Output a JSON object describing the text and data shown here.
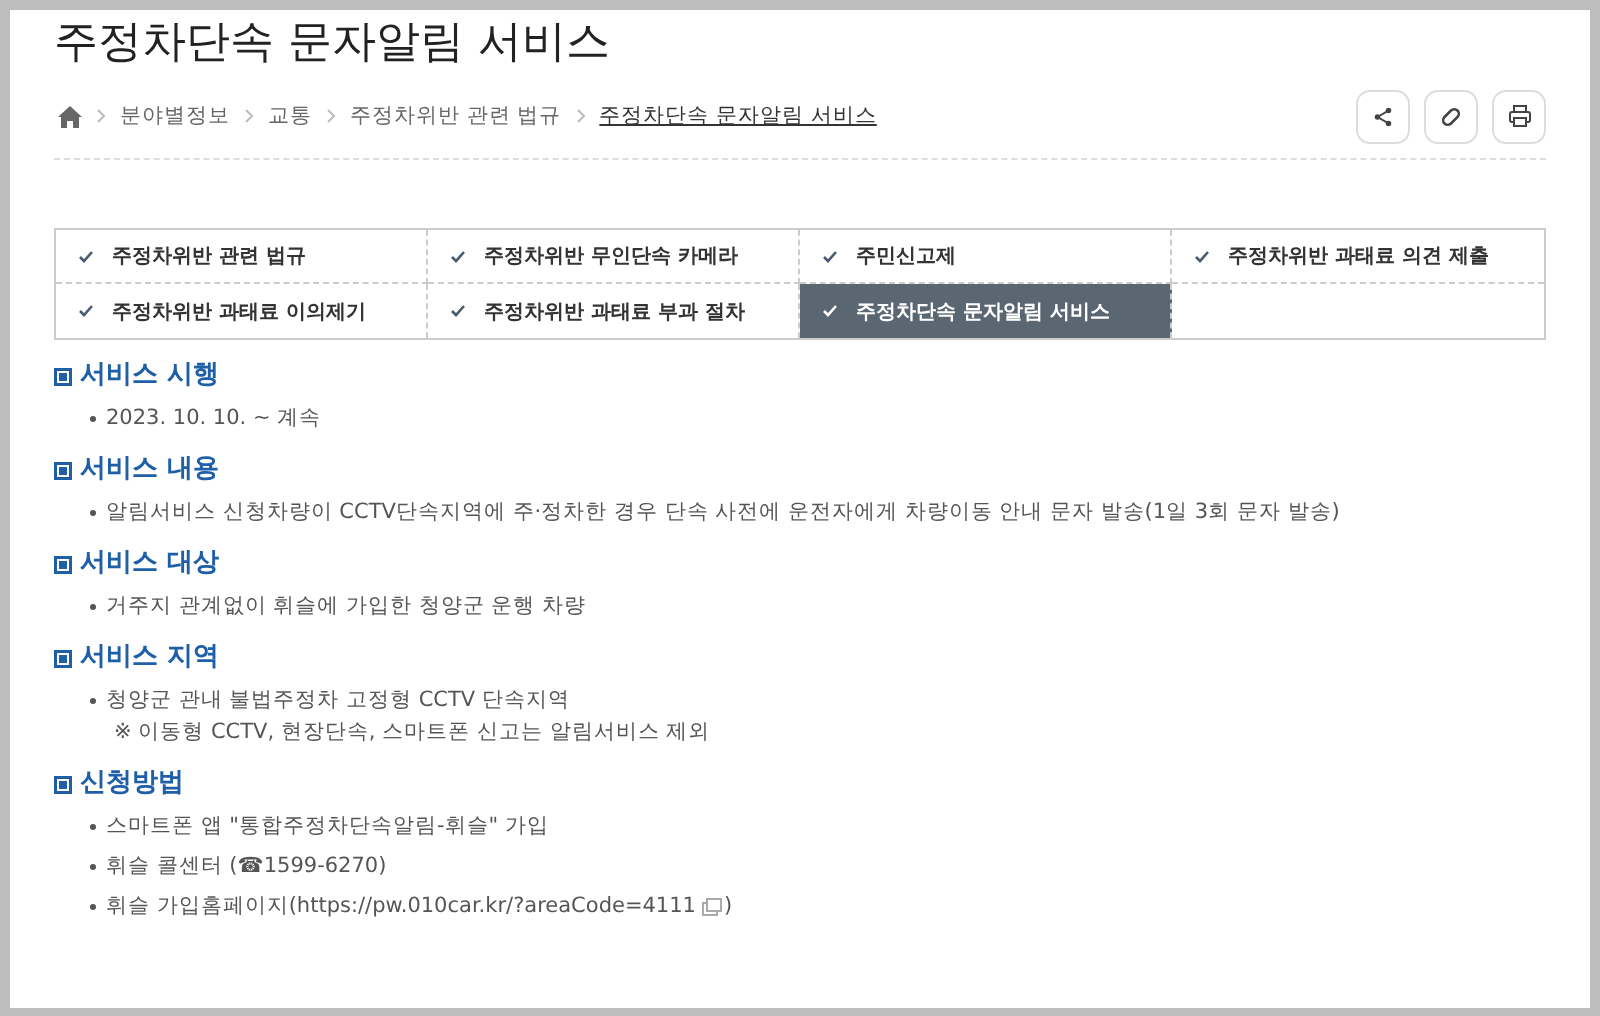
{
  "title": "주정차단속 문자알림 서비스",
  "breadcrumb": [
    {
      "label": "분야별정보",
      "current": false
    },
    {
      "label": "교통",
      "current": false
    },
    {
      "label": "주정차위반 관련 법규",
      "current": false
    },
    {
      "label": "주정차단속 문자알림 서비스",
      "current": true
    }
  ],
  "menu": [
    {
      "label": "주정차위반 관련 법규",
      "selected": false
    },
    {
      "label": "주정차위반 무인단속 카메라",
      "selected": false
    },
    {
      "label": "주민신고제",
      "selected": false
    },
    {
      "label": "주정차위반 과태료 의견 제출",
      "selected": false
    },
    {
      "label": "주정차위반 과태료 이의제기",
      "selected": false
    },
    {
      "label": "주정차위반 과태료 부과 절차",
      "selected": false
    },
    {
      "label": "주정차단속 문자알림 서비스",
      "selected": true
    }
  ],
  "sections": [
    {
      "heading": "서비스 시행",
      "lines": [
        {
          "kind": "bullet",
          "text": "2023. 10. 10. ~ 계속"
        }
      ]
    },
    {
      "heading": "서비스 내용",
      "lines": [
        {
          "kind": "bullet",
          "text": "알림서비스 신청차량이 CCTV단속지역에 주·정차한 경우 단속 사전에 운전자에게 차량이동 안내 문자 발송(1일 3회 문자 발송)"
        }
      ]
    },
    {
      "heading": "서비스 대상",
      "lines": [
        {
          "kind": "bullet",
          "text": "거주지 관계없이 휘슬에 가입한 청양군 운행 차량"
        }
      ]
    },
    {
      "heading": "서비스 지역",
      "lines": [
        {
          "kind": "bullet",
          "text": "청양군 관내 불법주정차 고정형 CCTV 단속지역"
        },
        {
          "kind": "note",
          "text": "※ 이동형 CCTV, 현장단속, 스마트폰 신고는 알림서비스 제외"
        }
      ]
    },
    {
      "heading": "신청방법",
      "lines": [
        {
          "kind": "bullet",
          "text": "스마트폰 앱 \"통합주정차단속알림-휘슬\" 가입"
        },
        {
          "kind": "bullet",
          "text": "휘슬 콜센터 (☎1599-6270)"
        },
        {
          "kind": "link",
          "text": "휘슬 가입홈페이지(https://pw.010car.kr/?areaCode=4111",
          "suffix": ")"
        }
      ]
    }
  ]
}
